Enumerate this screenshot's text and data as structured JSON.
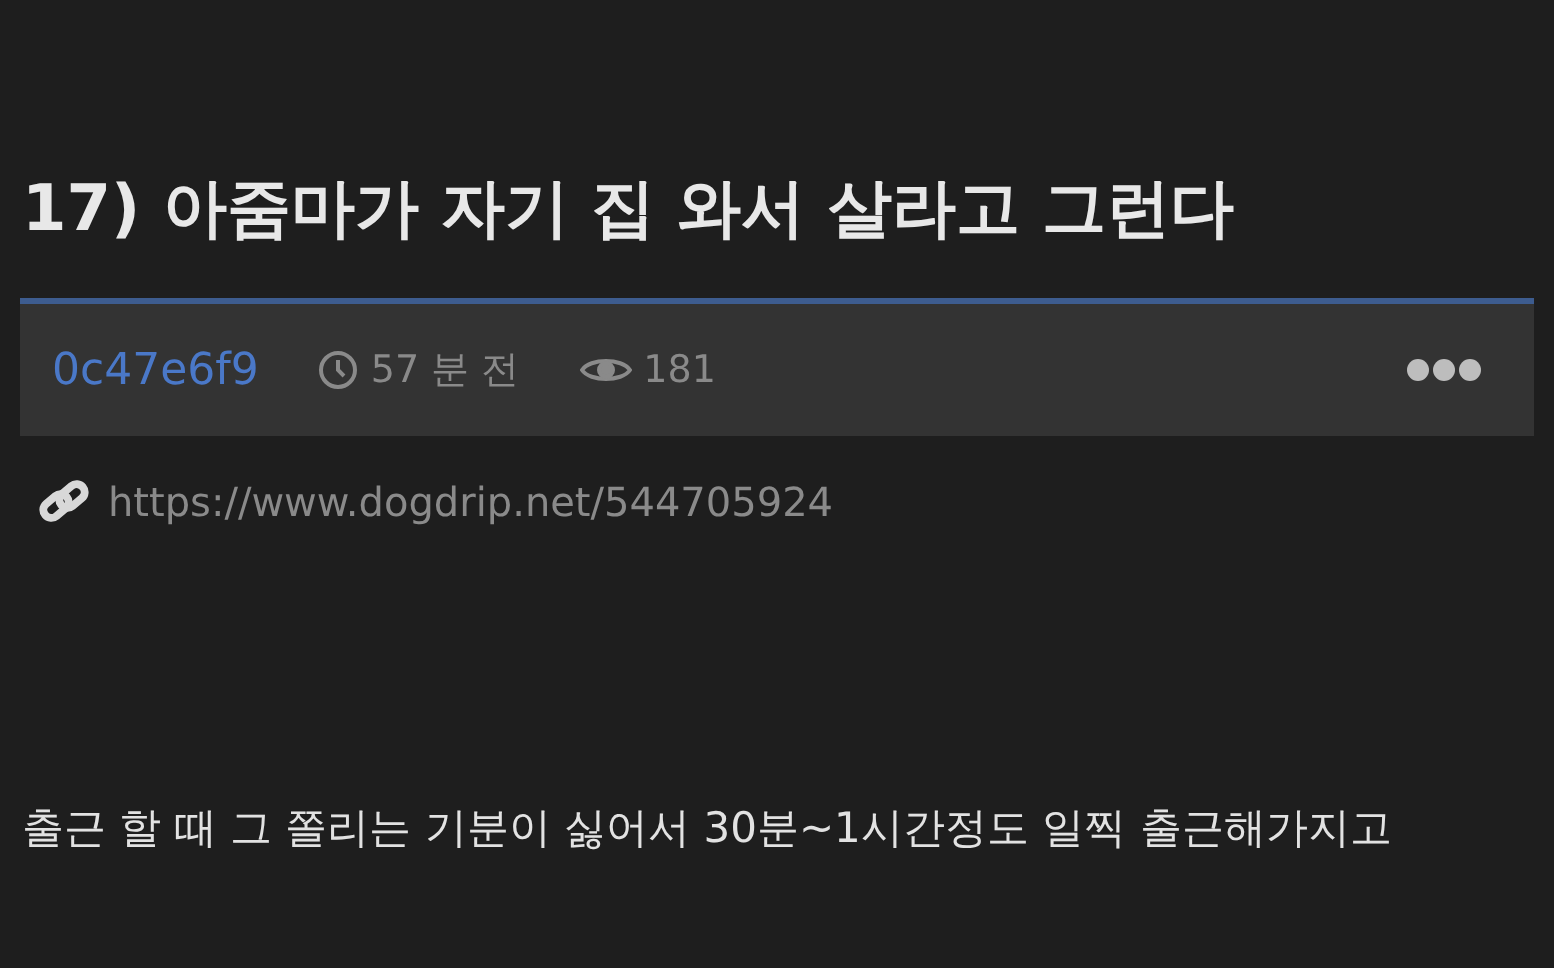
{
  "title": "17) 아줌마가 자기 집 와서 살라고 그런다",
  "meta": {
    "author": "0c47e6f9",
    "time": "57 분 전",
    "views": "181"
  },
  "link": "https://www.dogdrip.net/544705924",
  "body": "출근 할 때 그 쫄리는 기분이 싫어서 30분~1시간정도 일찍 출근해가지고"
}
